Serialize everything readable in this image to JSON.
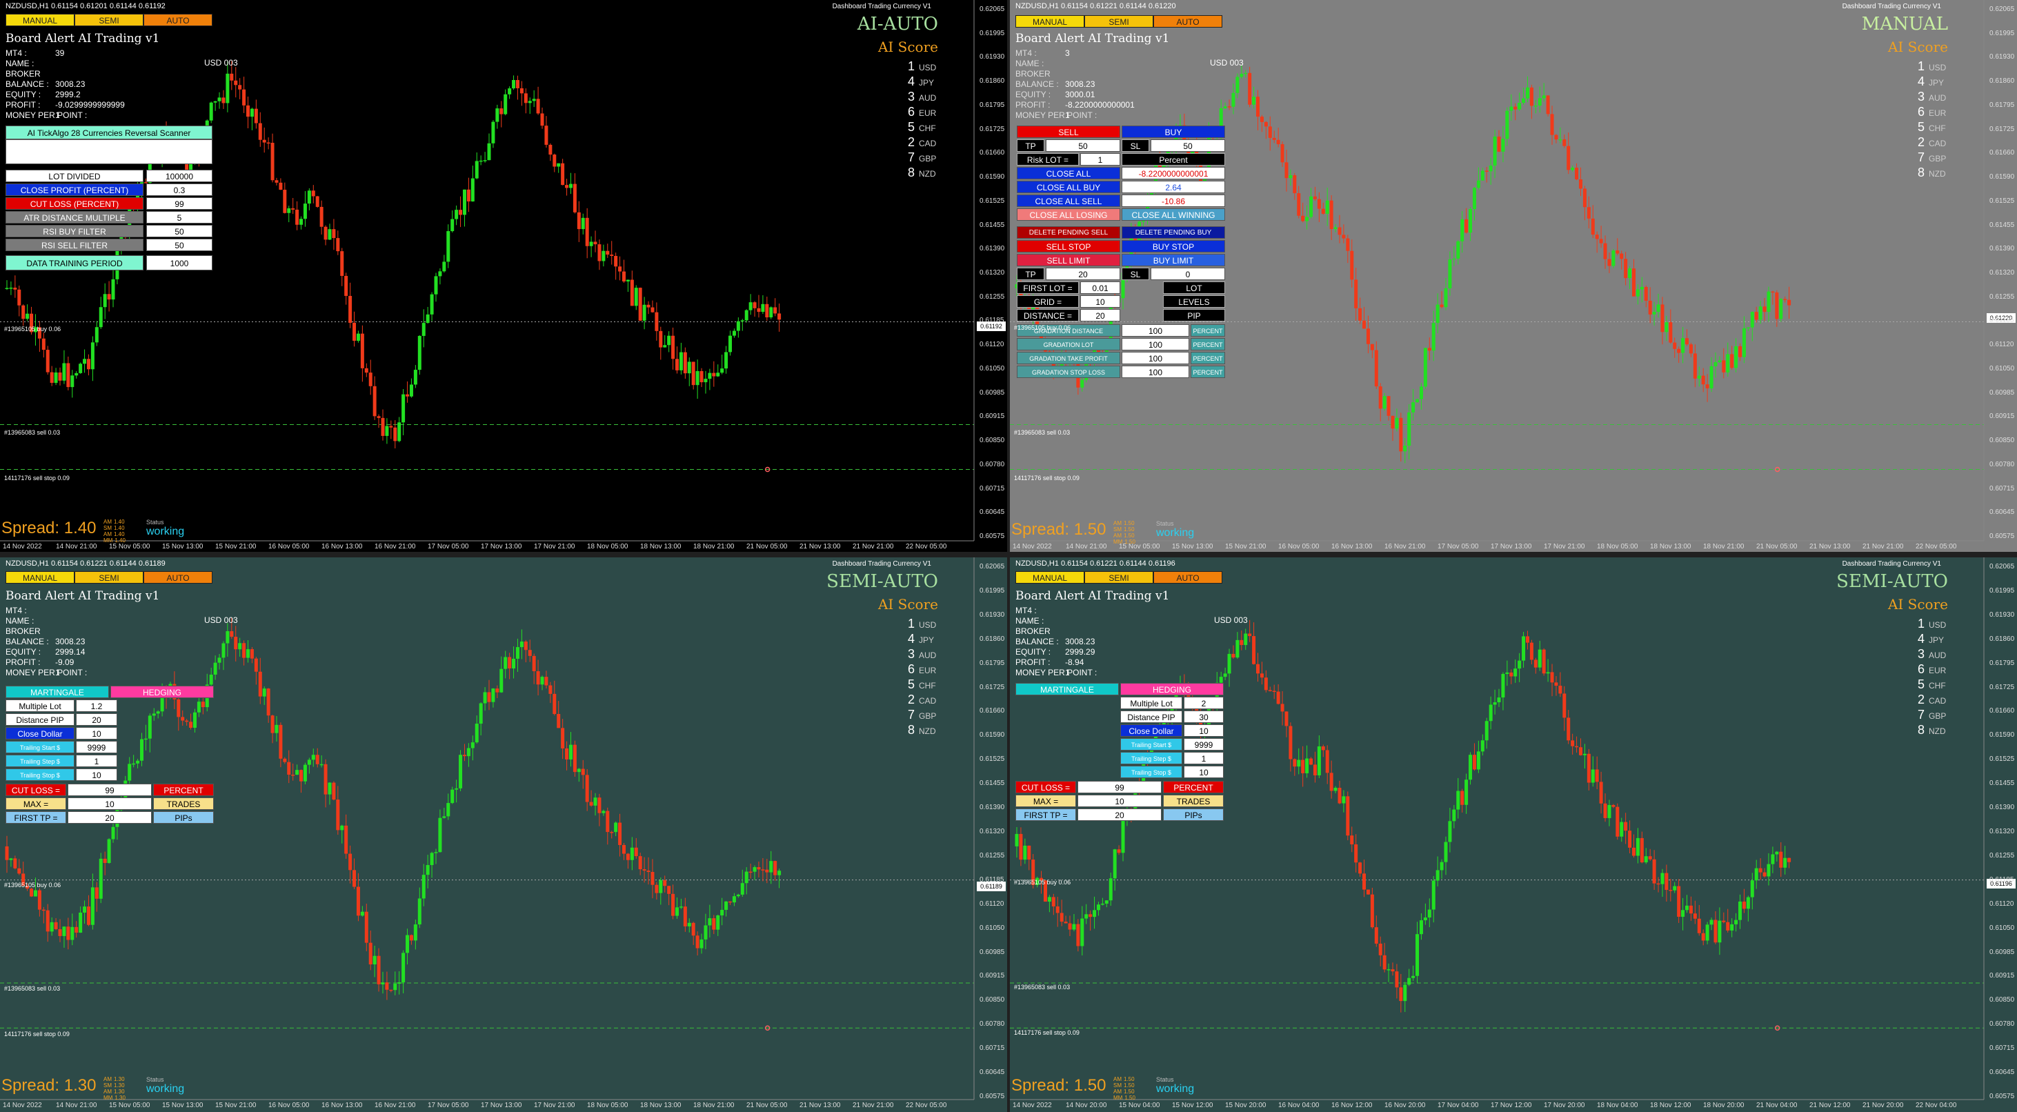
{
  "common": {
    "dashboard_label": "Dashboard Trading Currency V1",
    "modes": [
      "MANUAL",
      "SEMI",
      "AUTO"
    ],
    "board_title": "Board Alert  AI Trading v1",
    "ai_score": "AI Score",
    "currencies": [
      {
        "rank": "1",
        "name": "USD"
      },
      {
        "rank": "4",
        "name": "JPY"
      },
      {
        "rank": "3",
        "name": "AUD"
      },
      {
        "rank": "6",
        "name": "EUR"
      },
      {
        "rank": "5",
        "name": "CHF"
      },
      {
        "rank": "2",
        "name": "CAD"
      },
      {
        "rank": "7",
        "name": "GBP"
      },
      {
        "rank": "8",
        "name": "NZD"
      }
    ],
    "account_labels": [
      "MT4 :",
      "NAME  :",
      "BROKER",
      "BALANCE  :",
      "EQUITY  :",
      "PROFIT  :",
      "MONEY PER POINT  :"
    ],
    "usd_label": "USD 003",
    "status_label": "Status",
    "status_value": "working",
    "spread_small": [
      "AM",
      "SM",
      "AM",
      "MM"
    ],
    "trade_labels": [
      "#13965105 buy 0.06",
      "#13965083 sell 0.03",
      "14117176 sell stop 0.09"
    ],
    "price_ticks": [
      "0.62065",
      "0.61995",
      "0.61930",
      "0.61860",
      "0.61795",
      "0.61725",
      "0.61660",
      "0.61590",
      "0.61525",
      "0.61455",
      "0.61390",
      "0.61320",
      "0.61255",
      "0.61185",
      "0.61120",
      "0.61050",
      "0.60985",
      "0.60915",
      "0.60850",
      "0.60780",
      "0.60715",
      "0.60645",
      "0.60575"
    ],
    "time_ticks_a": [
      "14 Nov 2022",
      "14 Nov 21:00",
      "15 Nov 05:00",
      "15 Nov 13:00",
      "15 Nov 21:00",
      "16 Nov 05:00",
      "16 Nov 13:00",
      "16 Nov 21:00",
      "17 Nov 05:00",
      "17 Nov 13:00",
      "17 Nov 21:00",
      "18 Nov 05:00",
      "18 Nov 13:00",
      "18 Nov 21:00",
      "21 Nov 05:00",
      "21 Nov 13:00",
      "21 Nov 21:00",
      "22 Nov 05:00"
    ],
    "time_ticks_b": [
      "14 Nov 2022",
      "14 Nov 20:00",
      "15 Nov 04:00",
      "15 Nov 12:00",
      "15 Nov 20:00",
      "16 Nov 04:00",
      "16 Nov 12:00",
      "16 Nov 20:00",
      "17 Nov 04:00",
      "17 Nov 12:00",
      "17 Nov 20:00",
      "18 Nov 04:00",
      "18 Nov 12:00",
      "18 Nov 20:00",
      "21 Nov 04:00",
      "21 Nov 12:00",
      "21 Nov 20:00",
      "22 Nov 04:00"
    ]
  },
  "quads": [
    {
      "id": "tl",
      "header": "NZDUSD,H1  0.61154 0.61201 0.61144 0.61192",
      "mode_title": "AI-AUTO",
      "title_color": "#a8e0a0",
      "bg": "#000000",
      "account": {
        "mt4": "39",
        "name": "",
        "broker": "",
        "balance": "3008.23",
        "equity": "2999.2",
        "profit": "-9.0299999999999",
        "mpp": "1"
      },
      "price_tag": "0.61192",
      "spread": "Spread: 1.40",
      "spread_vals": [
        "1.40",
        "1.40",
        "1.40",
        "1.40"
      ]
    },
    {
      "id": "tr",
      "header": "NZDUSD,H1  0.61154 0.61221 0.61144 0.61220",
      "mode_title": "MANUAL",
      "title_color": "#c8f0a0",
      "bg": "#808080",
      "account": {
        "mt4": "3",
        "name": "",
        "broker": "",
        "balance": "3008.23",
        "equity": "3000.01",
        "profit": "-8.2200000000001",
        "mpp": "1"
      },
      "price_tag": "0.61220",
      "spread": "Spread: 1.50",
      "spread_vals": [
        "1.50",
        "1.50",
        "1.50",
        "1.50"
      ]
    },
    {
      "id": "bl",
      "header": "NZDUSD,H1  0.61154 0.61221 0.61144 0.61189",
      "mode_title": "SEMI-AUTO",
      "title_color": "#a8e0a0",
      "bg": "#2d4a48",
      "account": {
        "mt4": "",
        "name": "",
        "broker": "",
        "balance": "3008.23",
        "equity": "2999.14",
        "profit": "-9.09",
        "mpp": "1"
      },
      "price_tag": "0.61189",
      "spread": "Spread: 1.30",
      "spread_vals": [
        "1.30",
        "1.30",
        "1.30",
        "1.30"
      ]
    },
    {
      "id": "br",
      "header": "NZDUSD,H1  0.61154 0.61221 0.61144 0.61196",
      "mode_title": "SEMI-AUTO",
      "title_color": "#a8e0a0",
      "bg": "#2d4a48",
      "account": {
        "mt4": "",
        "name": "",
        "broker": "",
        "balance": "3008.23",
        "equity": "2999.29",
        "profit": "-8.94",
        "mpp": "1"
      },
      "price_tag": "0.61196",
      "spread": "Spread: 1.50",
      "spread_vals": [
        "1.50",
        "1.50",
        "1.50",
        "1.50"
      ]
    }
  ],
  "ai_auto_panel": {
    "scanner": "AI TickAlgo 28 Currencies Reversal Scanner",
    "rows": [
      {
        "label": "LOT DIVIDED",
        "value": "100000"
      },
      {
        "label": "CLOSE PROFIT (PERCENT)",
        "value": "0.3"
      },
      {
        "label": "CUT LOSS (PERCENT)",
        "value": "99"
      },
      {
        "label": "ATR DISTANCE MULTIPLE",
        "value": "5"
      },
      {
        "label": "RSI BUY FILTER",
        "value": "50"
      },
      {
        "label": "RSI SELL FILTER",
        "value": "50"
      },
      {
        "label": "DATA TRAINING PERIOD",
        "value": "1000"
      }
    ]
  },
  "manual_panel": {
    "sell": "SELL",
    "buy": "BUY",
    "tp": "TP",
    "tp_val": "50",
    "sl": "SL",
    "sl_val": "50",
    "risk_lot": "Risk LOT =",
    "risk_val": "1",
    "percent": "Percent",
    "close_all": "CLOSE ALL",
    "close_all_val": "-8.2200000000001",
    "close_all_buy": "CLOSE ALL BUY",
    "close_all_buy_val": "2.64",
    "close_all_sell": "CLOSE ALL SELL",
    "close_all_sell_val": "-10.86",
    "close_all_losing": "CLOSE ALL LOSING",
    "close_all_winning": "CLOSE ALL WINNING",
    "del_pending_sell": "DELETE PENDING SELL",
    "del_pending_buy": "DELETE PENDING BUY",
    "sell_stop": "SELL STOP",
    "buy_stop": "BUY STOP",
    "sell_limit": "SELL LIMIT",
    "buy_limit": "BUY LIMIT",
    "tp2": "TP",
    "tp2_val": "20",
    "sl2": "SL",
    "sl2_val": "0",
    "first_lot": "FIRST LOT =",
    "first_lot_val": "0.01",
    "lot": "LOT",
    "grid": "GRID =",
    "grid_val": "10",
    "levels": "LEVELS",
    "distance": "DISTANCE =",
    "distance_val": "20",
    "pip": "PIP",
    "gradations": [
      {
        "label": "GRADATION DISTANCE",
        "value": "100",
        "unit": "PERCENT"
      },
      {
        "label": "GRADATION LOT",
        "value": "100",
        "unit": "PERCENT"
      },
      {
        "label": "GRADATION TAKE PROFIT",
        "value": "100",
        "unit": "PERCENT"
      },
      {
        "label": "GRADATION STOP LOSS",
        "value": "100",
        "unit": "PERCENT"
      }
    ]
  },
  "semi_panels": [
    {
      "martingale": "MARTINGALE",
      "hedging": "HEDGING",
      "rows": [
        {
          "label": "Multiple Lot",
          "value": "1.2"
        },
        {
          "label": "Distance PIP",
          "value": "20"
        },
        {
          "label": "Close Dollar",
          "value": "10"
        },
        {
          "label": "Trailing Start $",
          "value": "9999"
        },
        {
          "label": "Trailing Step $",
          "value": "1"
        },
        {
          "label": "Trailing Stop $",
          "value": "10"
        }
      ],
      "cut_loss": "CUT LOSS =",
      "cut_loss_val": "99",
      "cut_unit": "PERCENT",
      "max": "MAX =",
      "max_val": "10",
      "max_unit": "TRADES",
      "first_tp": "FIRST TP =",
      "first_tp_val": "20",
      "tp_unit": "PIPs"
    },
    {
      "martingale": "MARTINGALE",
      "hedging": "HEDGING",
      "rows": [
        {
          "label": "Multiple Lot",
          "value": "2"
        },
        {
          "label": "Distance PIP",
          "value": "30"
        },
        {
          "label": "Close Dollar",
          "value": "10"
        },
        {
          "label": "Trailing Start $",
          "value": "9999"
        },
        {
          "label": "Trailing Step $",
          "value": "1"
        },
        {
          "label": "Trailing Stop $",
          "value": "10"
        }
      ],
      "cut_loss": "CUT LOSS =",
      "cut_loss_val": "99",
      "cut_unit": "PERCENT",
      "max": "MAX =",
      "max_val": "10",
      "max_unit": "TRADES",
      "first_tp": "FIRST TP =",
      "first_tp_val": "20",
      "tp_unit": "PIPs"
    }
  ],
  "colors": {
    "bull": "#22e022",
    "bear": "#f03a1a",
    "accent": "#f0a020",
    "working": "#2ad0f0"
  }
}
